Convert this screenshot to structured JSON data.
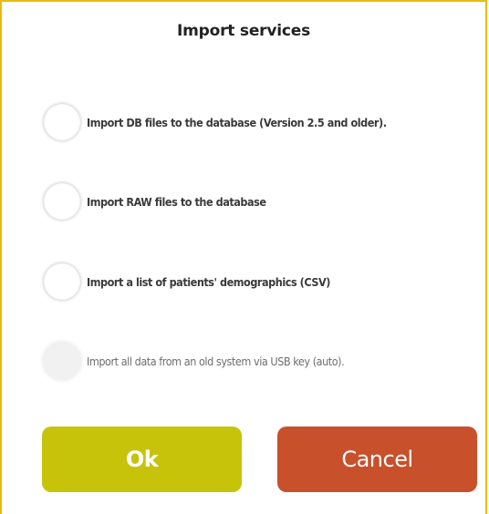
{
  "dialog": {
    "title": "Import services",
    "options": [
      {
        "label": "Import DB files to the database (Version 2.5 and older).",
        "selected": false,
        "enabled": true
      },
      {
        "label": "Import RAW files to the database",
        "selected": false,
        "enabled": true
      },
      {
        "label": "Import a list of patients' demographics (CSV)",
        "selected": false,
        "enabled": true
      },
      {
        "label": "Import all data from an old system via USB key (auto).",
        "selected": false,
        "enabled": false
      }
    ],
    "buttons": {
      "ok_label": "Ok",
      "cancel_label": "Cancel"
    }
  },
  "colors": {
    "border": "#e6bc10",
    "ok_button": "#c7c30b",
    "cancel_button": "#c8502a"
  }
}
